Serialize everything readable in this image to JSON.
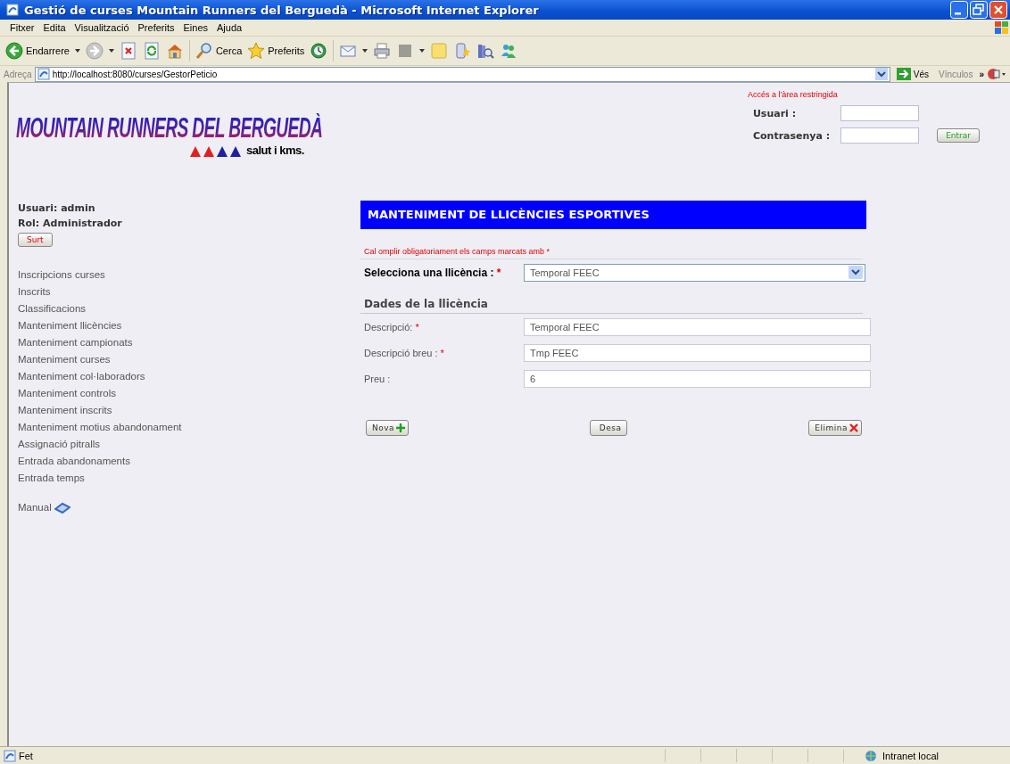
{
  "window": {
    "title": "Gestió de curses Mountain Runners del Berguedà - Microsoft Internet Explorer"
  },
  "menu_bar": [
    "Fitxer",
    "Edita",
    "Visualització",
    "Preferits",
    "Eines",
    "Ajuda"
  ],
  "toolbar": {
    "labels": [
      "Endarrere",
      "Cerca",
      "Preferits"
    ]
  },
  "address_bar": {
    "label": "Adreça",
    "url": "http://localhost:8080/curses/GestorPeticio",
    "go": "Vés",
    "links": "Vínculos",
    "more": "»"
  },
  "header": {
    "logo_title": "MOUNTAIN RUNNERS DEL BERGUEDÀ",
    "logo_slogan": "salut i kms.",
    "login": {
      "notice": "Accés a l'àrea restringida",
      "fields": [
        {
          "label": "Usuari :"
        },
        {
          "label": "Contrasenya :"
        }
      ],
      "button": "Entrar"
    }
  },
  "sidebar": {
    "user": "Usuari: admin",
    "role": "Rol: Administrador",
    "logout": "Surt",
    "items": [
      "Inscripcions curses",
      "Inscrits",
      "Classificacions",
      "Manteniment llicències",
      "Manteniment campionats",
      "Manteniment curses",
      "Manteniment col·laboradors",
      "Manteniment controls",
      "Manteniment inscrits",
      "Manteniment motius abandonament",
      "Assignació pitralls",
      "Entrada abandonaments",
      "Entrada temps"
    ],
    "manual": "Manual"
  },
  "form": {
    "title": "MANTENIMENT DE LLICÈNCIES ESPORTIVES",
    "note": "Cal omplir obligatoriament els camps marcats amb",
    "note_mark": "*",
    "select": {
      "label": "Selecciona una llicència :",
      "mark": "*",
      "value": "Temporal FEEC"
    },
    "section": "Dades de la llicència",
    "fields": [
      {
        "label": "Descripció:",
        "mark": "*",
        "value": "Temporal FEEC"
      },
      {
        "label": "Descripció breu :",
        "mark": "*",
        "value": "Tmp FEEC"
      },
      {
        "label": "Preu :",
        "value": "6"
      }
    ],
    "buttons": [
      {
        "label": "Nova",
        "kind": "add"
      },
      {
        "label": "Desa",
        "kind": "save"
      },
      {
        "label": "Elimina",
        "kind": "delete"
      }
    ]
  },
  "status_bar": {
    "text": "Fet",
    "zone": "Intranet local"
  }
}
